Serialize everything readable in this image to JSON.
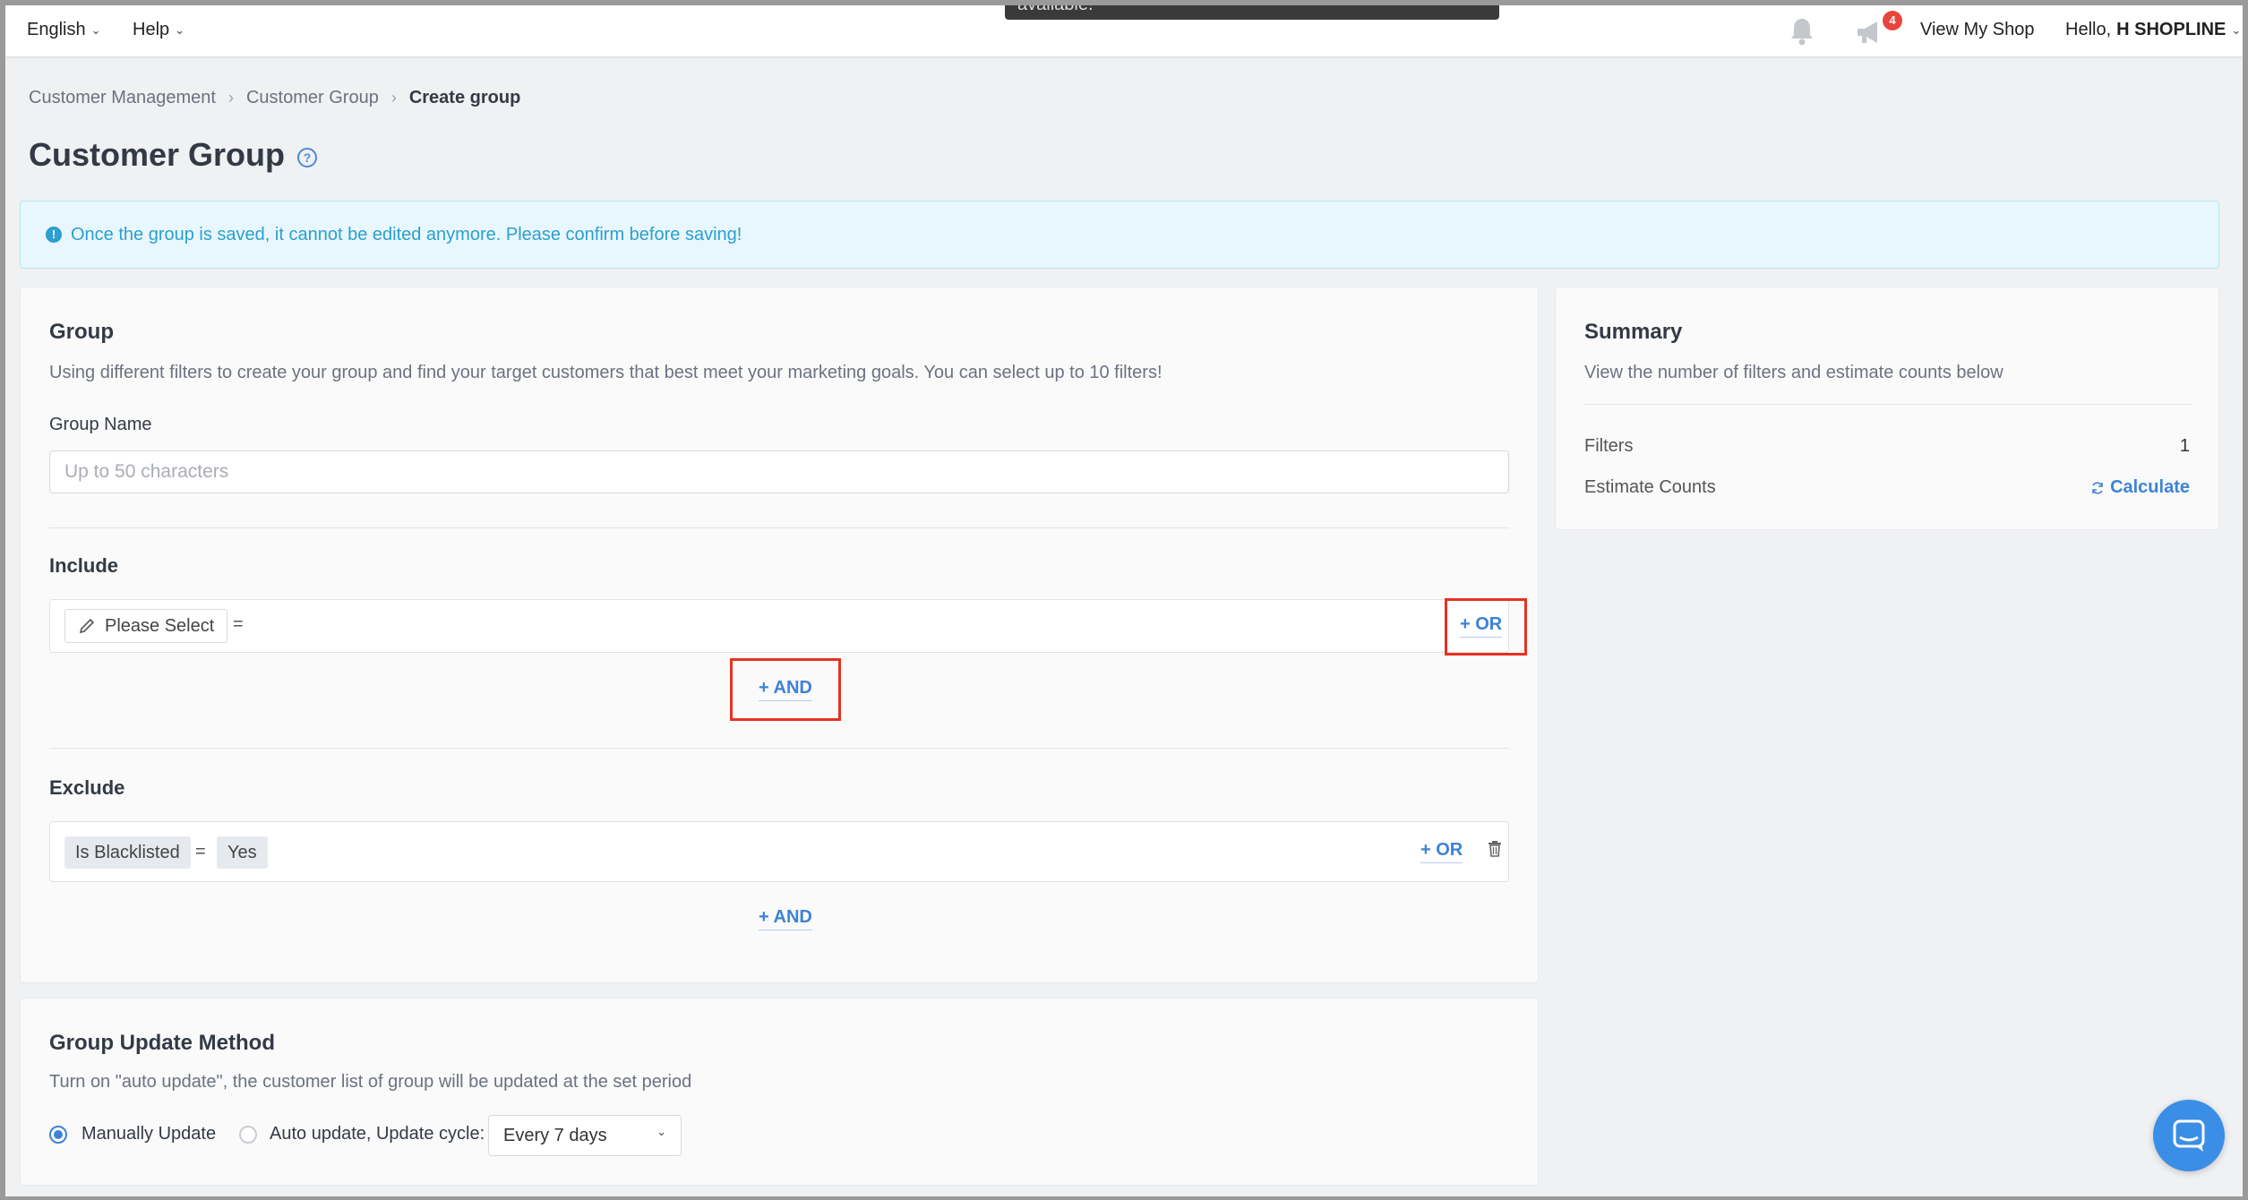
{
  "topbar": {
    "language": "English",
    "help": "Help",
    "toast_text": "available.",
    "notification_badge": "4",
    "view_shop": "View My Shop",
    "greeting_prefix": "Hello,",
    "user_name": "H SHOPLINE"
  },
  "breadcrumb": {
    "items": [
      "Customer Management",
      "Customer Group",
      "Create group"
    ]
  },
  "page": {
    "title": "Customer Group"
  },
  "alert": {
    "text": "Once the group is saved, it cannot be edited anymore. Please confirm before saving!"
  },
  "group": {
    "title": "Group",
    "description": "Using different filters to create your group and find your target customers that best meet your marketing goals. You can select up to 10 filters!",
    "name_label": "Group Name",
    "name_placeholder": "Up to 50 characters",
    "name_value": ""
  },
  "include": {
    "title": "Include",
    "select_label": "Please Select",
    "operator": "=",
    "or_label": "+ OR",
    "and_label": "+ AND"
  },
  "exclude": {
    "title": "Exclude",
    "field": "Is Blacklisted",
    "operator": "=",
    "value": "Yes",
    "or_label": "+ OR",
    "and_label": "+ AND"
  },
  "summary": {
    "title": "Summary",
    "description": "View the number of filters and estimate counts below",
    "filters_label": "Filters",
    "filters_value": "1",
    "estimate_label": "Estimate Counts",
    "calculate_label": "Calculate"
  },
  "update_method": {
    "title": "Group Update Method",
    "description": "Turn on \"auto update\", the customer list of group will be updated at the set period",
    "manual_label": "Manually Update",
    "auto_label": "Auto update, Update cycle:",
    "cycle_value": "Every 7 days",
    "selected": "manual"
  },
  "colors": {
    "accent": "#3d82d6",
    "highlight": "#e63222",
    "alert_text": "#2a9fd0"
  }
}
